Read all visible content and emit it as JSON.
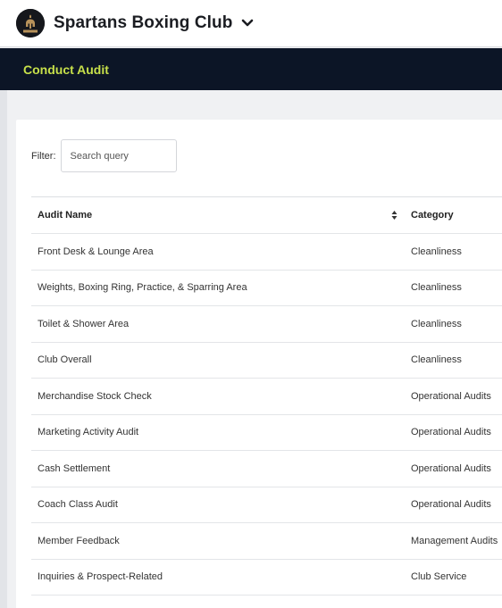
{
  "header": {
    "club_name": "Spartans Boxing Club",
    "logo_text": "SPARTANS",
    "chevron_icon": "chevron-down-icon"
  },
  "nav": {
    "title": "Conduct Audit"
  },
  "filter": {
    "label": "Filter:",
    "placeholder": "Search query",
    "value": ""
  },
  "table": {
    "columns": [
      "Audit Name",
      "Category"
    ],
    "sort_icon": "sort-icon",
    "rows": [
      {
        "name": "Front Desk & Lounge Area",
        "category": "Cleanliness"
      },
      {
        "name": "Weights, Boxing Ring, Practice, & Sparring Area",
        "category": "Cleanliness"
      },
      {
        "name": "Toilet & Shower Area",
        "category": "Cleanliness"
      },
      {
        "name": "Club Overall",
        "category": "Cleanliness"
      },
      {
        "name": "Merchandise Stock Check",
        "category": "Operational Audits"
      },
      {
        "name": "Marketing Activity Audit",
        "category": "Operational Audits"
      },
      {
        "name": "Cash Settlement",
        "category": "Operational Audits"
      },
      {
        "name": "Coach Class Audit",
        "category": "Operational Audits"
      },
      {
        "name": "Member Feedback",
        "category": "Management Audits"
      },
      {
        "name": "Inquiries & Prospect-Related",
        "category": "Club Service"
      }
    ]
  },
  "colors": {
    "nav_bg": "#0c1526",
    "nav_title": "#c7e04a",
    "page_bg": "#f0f1f3"
  }
}
